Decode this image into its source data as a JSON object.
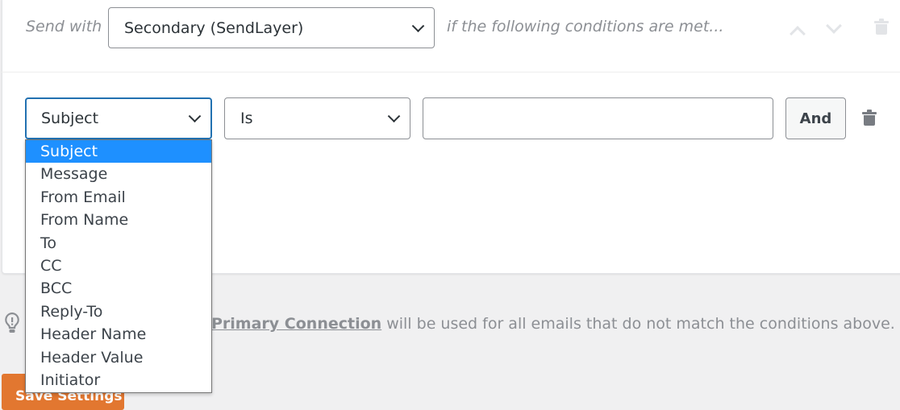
{
  "rule": {
    "send_with_label": "Send with",
    "connection_value": "Secondary (SendLayer)",
    "conditions_text": "if the following conditions are met..."
  },
  "condition": {
    "field_value": "Subject",
    "operator_value": "Is",
    "value_input": "",
    "and_label": "And"
  },
  "dropdown": {
    "options": [
      "Subject",
      "Message",
      "From Email",
      "From Name",
      "To",
      "CC",
      "BCC",
      "Reply-To",
      "Header Name",
      "Header Value",
      "Initiator"
    ],
    "selected": "Subject"
  },
  "note": {
    "link": "Primary Connection",
    "text": " will be used for all emails that do not match the conditions above."
  },
  "save_label": "Save Settings",
  "colors": {
    "accent": "#e27730",
    "highlight": "#1e90ff",
    "focus": "#2271b1"
  }
}
